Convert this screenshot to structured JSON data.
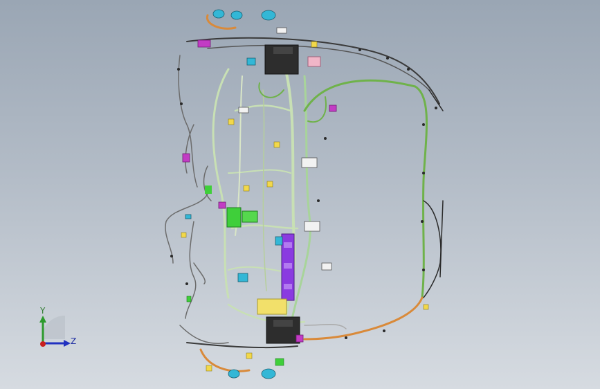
{
  "view": {
    "type": "3d-cad-viewport",
    "background_top": "#9aa6b4",
    "background_bottom": "#d6dbe1"
  },
  "model": {
    "wire_colors": {
      "green": "#6fb24a",
      "pale_green": "#c8e0b4",
      "orange": "#d98a3a",
      "gray": "#6c6c6c",
      "dark": "#2a2a2a"
    },
    "component_colors": {
      "magenta": "#c23cc4",
      "purple": "#8a3be0",
      "cyan": "#33b7d6",
      "yellow": "#f2e06a",
      "pink": "#f0b6c8",
      "bright_green": "#3fcf3a",
      "dark_box": "#2d2d2d"
    }
  },
  "triad": {
    "y_label": "Y",
    "z_label": "Z",
    "y_color": "#2c9a2c",
    "z_color": "#2030c0",
    "x_color": "#c82020"
  }
}
